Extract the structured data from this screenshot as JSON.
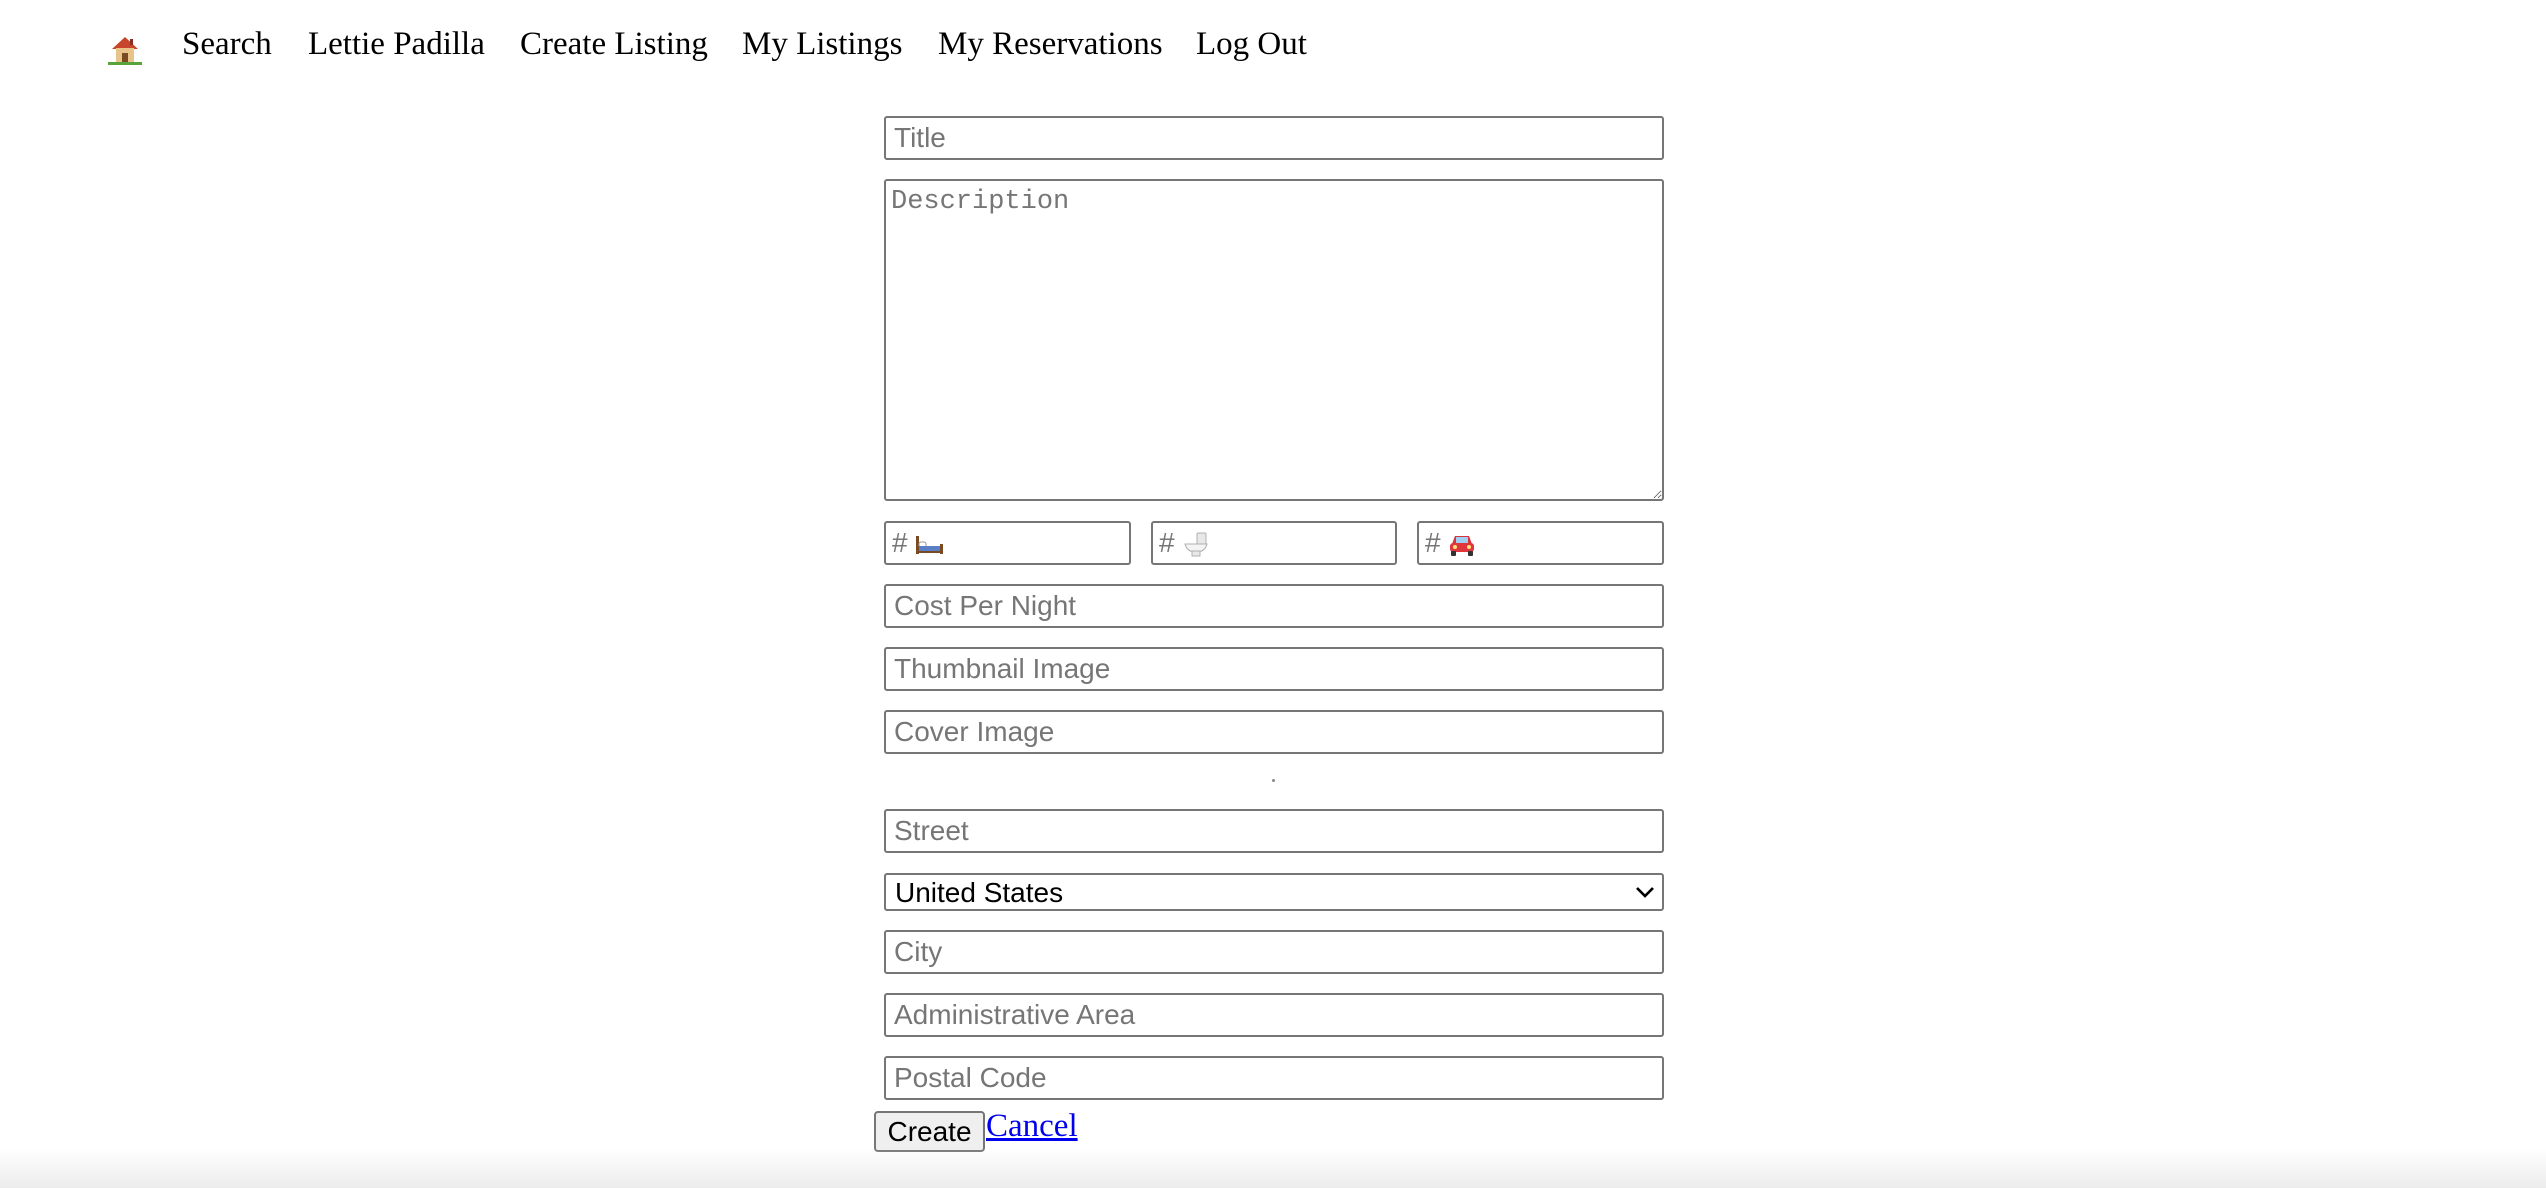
{
  "nav": {
    "home_icon": "house-emoji",
    "items": [
      {
        "label": "Search"
      },
      {
        "label": "Lettie Padilla"
      },
      {
        "label": "Create Listing"
      },
      {
        "label": "My Listings"
      },
      {
        "label": "My Reservations"
      },
      {
        "label": "Log Out"
      }
    ]
  },
  "form": {
    "title_placeholder": "Title",
    "description_placeholder": "Description",
    "bedrooms": {
      "prefix": "#",
      "icon": "bed-emoji"
    },
    "bathrooms": {
      "prefix": "#",
      "icon": "toilet-emoji"
    },
    "parking": {
      "prefix": "#",
      "icon": "car-emoji"
    },
    "cost_placeholder": "Cost Per Night",
    "thumbnail_placeholder": "Thumbnail Image",
    "cover_placeholder": "Cover Image",
    "street_placeholder": "Street",
    "country_selected": "United States",
    "city_placeholder": "City",
    "admin_area_placeholder": "Administrative Area",
    "postal_placeholder": "Postal Code",
    "create_label": "Create",
    "cancel_label": "Cancel"
  },
  "colors": {
    "border": "#767676",
    "placeholder": "#767676",
    "link": "#0000ee",
    "button_bg": "#efefef"
  }
}
